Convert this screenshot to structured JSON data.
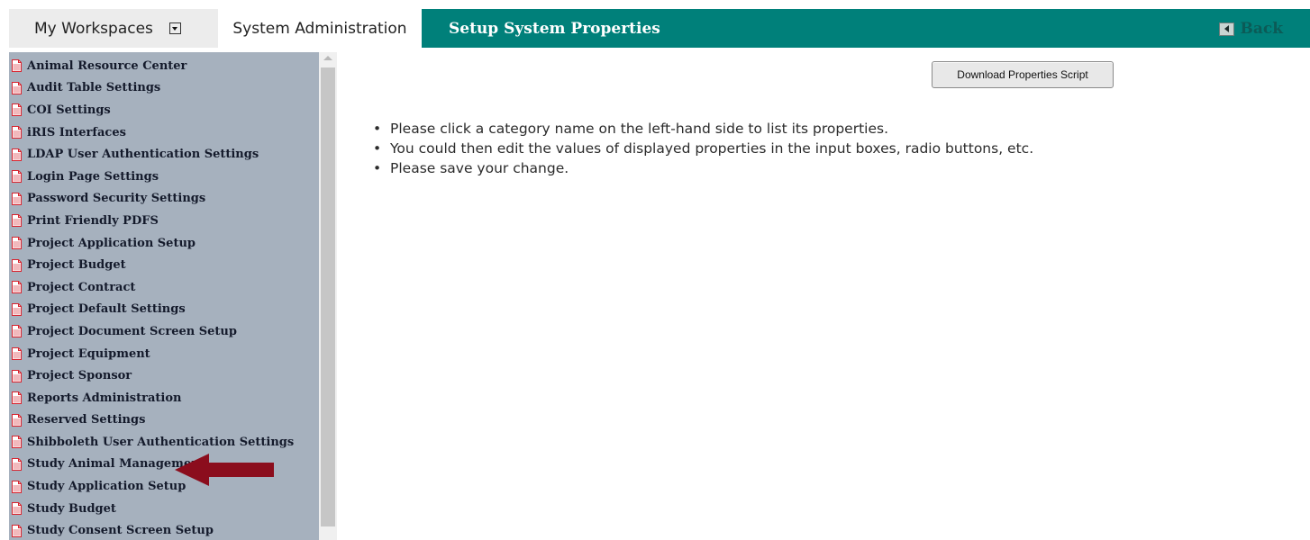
{
  "tabs": {
    "workspaces_label": "My Workspaces",
    "sysadmin_label": "System Administration"
  },
  "header": {
    "title": "Setup System Properties",
    "back_label": "Back"
  },
  "sidebar": {
    "items": [
      "Animal Resource Center",
      "Audit Table Settings",
      "COI Settings",
      "iRIS Interfaces",
      "LDAP User Authentication Settings",
      "Login Page Settings",
      "Password Security Settings",
      "Print Friendly PDFS",
      "Project Application Setup",
      "Project Budget",
      "Project Contract",
      "Project Default Settings",
      "Project Document Screen Setup",
      "Project Equipment",
      "Project Sponsor",
      "Reports Administration",
      "Reserved Settings",
      "Shibboleth User Authentication Settings",
      "Study Animal Management",
      "Study Application Setup",
      "Study Budget",
      "Study Consent Screen Setup"
    ]
  },
  "main": {
    "download_label": "Download Properties Script",
    "instructions": [
      "Please click a category name on the left-hand side to list its properties.",
      "You could then edit the values of displayed properties in the input boxes, radio buttons, etc.",
      "Please save your change."
    ]
  },
  "colors": {
    "header_teal": "#00807a",
    "sidebar_bg": "#a6b1be",
    "arrow_red": "#8b0d1d",
    "doc_icon_red": "#d8242f"
  },
  "icons": {
    "category_item": "document-icon",
    "workspaces_dropdown": "dropdown-icon",
    "back": "back-arrow-icon",
    "annotation": "red-arrow-pointer"
  }
}
